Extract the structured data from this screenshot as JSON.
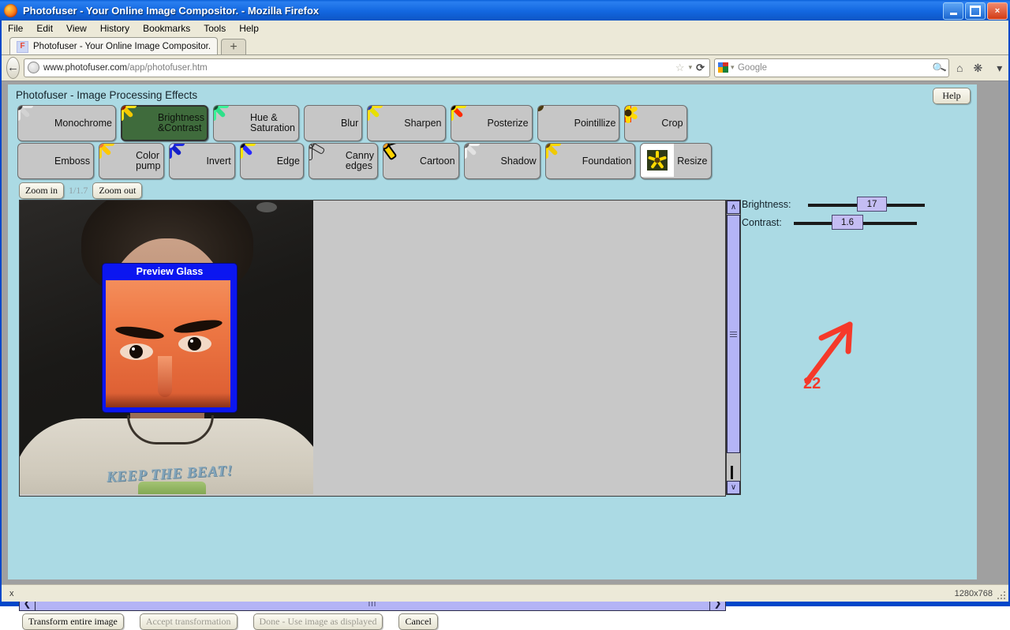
{
  "window": {
    "title": "Photofuser - Your Online Image Compositor. - Mozilla Firefox",
    "minimize_label": "Minimize",
    "maximize_label": "Maximize",
    "close_label": "×"
  },
  "menubar": {
    "items": [
      "File",
      "Edit",
      "View",
      "History",
      "Bookmarks",
      "Tools",
      "Help"
    ]
  },
  "tabs": {
    "active": {
      "title": "Photofuser - Your Online Image Compositor.",
      "favicon_letter": "F"
    },
    "new_tab_label": "+"
  },
  "navbar": {
    "back_glyph": "←",
    "url_prefix": "www.photofuser.com",
    "url_path": "/app/photofuser.htm",
    "bookmark_star": "☆",
    "bookmark_caret": "▾",
    "reload_glyph": "⟳",
    "search_placeholder": "Google",
    "search_magnifier": "🔍",
    "home_glyph": "⌂",
    "overflow_caret": "▾"
  },
  "app": {
    "title": "Photofuser - Image Processing Effects",
    "help_label": "Help",
    "background_color": "#abdae4",
    "effects_row1": [
      {
        "label": "Monochrome",
        "selected": false,
        "thumb": "mono-flower"
      },
      {
        "label": "Brightness\n&Contrast",
        "selected": true,
        "thumb": "bright-flower"
      },
      {
        "label": "Hue &\nSaturation",
        "selected": false,
        "thumb": "green-flower"
      },
      {
        "label": "Blur",
        "selected": false,
        "thumb": "blur-flower"
      },
      {
        "label": "Sharpen",
        "selected": false,
        "thumb": "sharp-flower"
      },
      {
        "label": "Posterize",
        "selected": false,
        "thumb": "poster-flower"
      },
      {
        "label": "Pointillize",
        "selected": false,
        "thumb": "point-flower"
      },
      {
        "label": "Crop",
        "selected": false,
        "thumb": "crop-flower"
      }
    ],
    "effects_row2": [
      {
        "label": "Emboss",
        "selected": false,
        "thumb": "emboss-flower"
      },
      {
        "label": "Color\npump",
        "selected": false,
        "thumb": "colorpump-flower"
      },
      {
        "label": "Invert",
        "selected": false,
        "thumb": "invert-flower"
      },
      {
        "label": "Edge",
        "selected": false,
        "thumb": "edge-flower"
      },
      {
        "label": "Canny\nedges",
        "selected": false,
        "thumb": "canny-flower"
      },
      {
        "label": "Cartoon",
        "selected": false,
        "thumb": "cartoon-flower"
      },
      {
        "label": "Shadow",
        "selected": false,
        "thumb": "shadow-flower"
      },
      {
        "label": "Foundation",
        "selected": false,
        "thumb": "foundation-flower"
      },
      {
        "label": "Resize",
        "selected": false,
        "thumb": "resize-flower"
      }
    ],
    "zoom": {
      "zoom_in_label": "Zoom in",
      "level": "1/1.7",
      "zoom_out_label": "Zoom out"
    },
    "preview_glass": {
      "title": "Preview Glass"
    },
    "photo": {
      "tshirt_text": "KEEP THE BEAT!"
    },
    "scrollbars": {
      "up_arrow": "∧",
      "down_arrow": "∨",
      "left_arrow": "❮",
      "right_arrow": "❯",
      "h_grip": "|||"
    },
    "controls": {
      "brightness_label": "Brightness:",
      "brightness_value": "17",
      "contrast_label": "Contrast:",
      "contrast_value": "1.6"
    },
    "annotation": {
      "number": "22",
      "color": "#f5392a"
    },
    "actions": [
      {
        "label": "Transform entire image",
        "enabled": true
      },
      {
        "label": "Accept transformation",
        "enabled": false
      },
      {
        "label": "Done - Use image as displayed",
        "enabled": false
      },
      {
        "label": "Cancel",
        "enabled": true
      }
    ]
  },
  "statusbar": {
    "left_text": "x",
    "right_text": "1280x768"
  }
}
